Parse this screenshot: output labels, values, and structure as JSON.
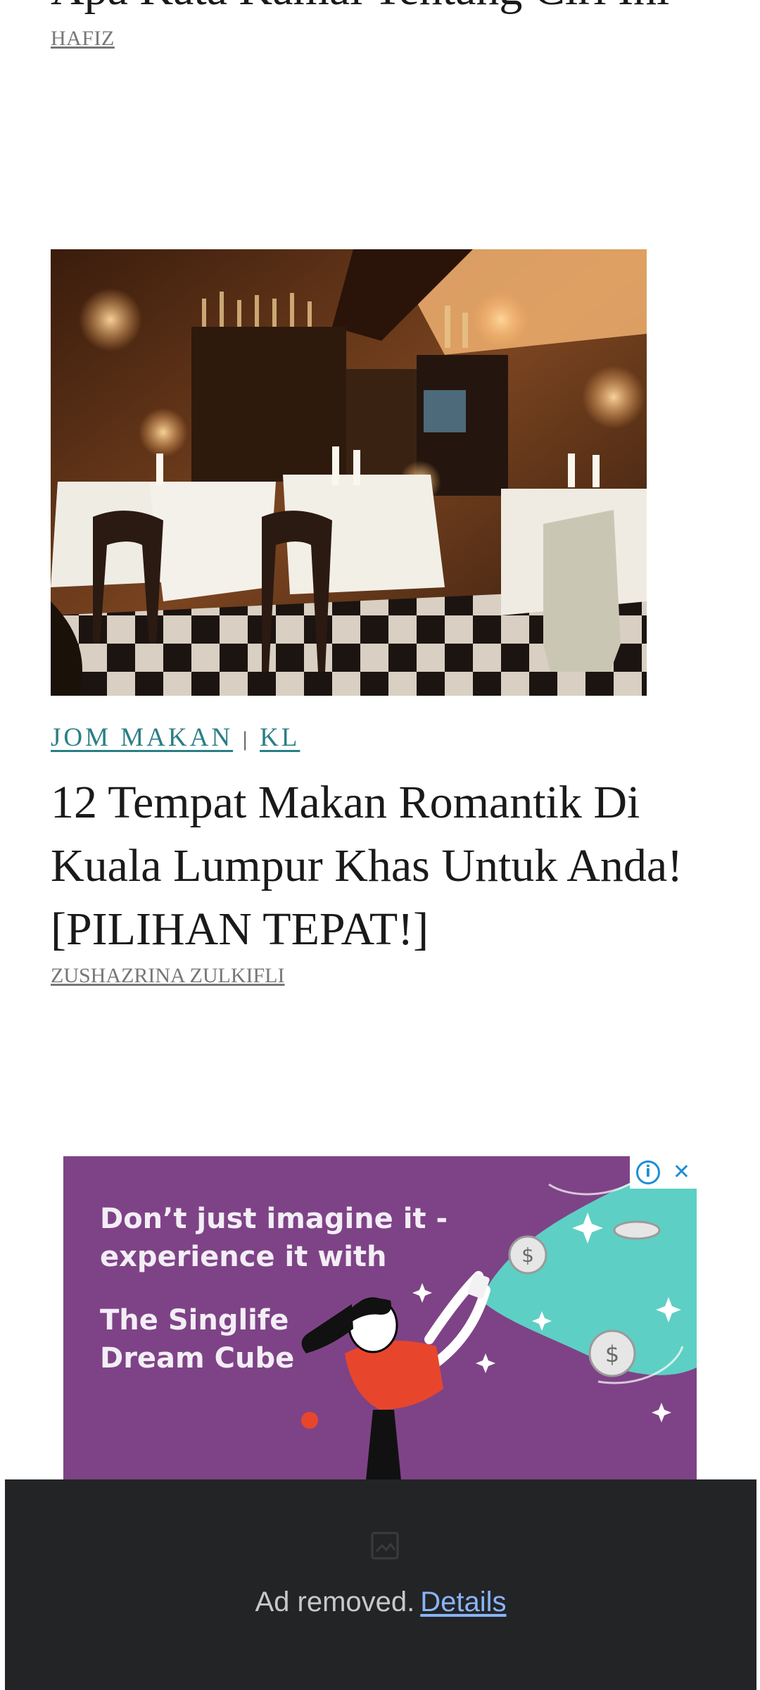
{
  "article_top": {
    "title": "Apa Kata Kamal Tentang Ciri Ini",
    "author": "HAFIZ"
  },
  "article_main": {
    "image_alt": "restaurant-interior-photo",
    "categories": [
      "JOM MAKAN",
      "KL"
    ],
    "separator": "|",
    "title": "12 Tempat Makan Romantik Di Kuala Lumpur Khas Untuk Anda! [PILIHAN TEPAT!]",
    "author": "ZUSHAZRINA ZULKIFLI"
  },
  "ad": {
    "line1": "Don’t just imagine it - experience it with",
    "line2": "The Singlife Dream Cube",
    "info_icon": "info-icon",
    "close_icon": "close-icon",
    "background": "#7e4386",
    "accent": "#5ecfc4"
  },
  "ad_removed": {
    "message": "Ad removed.",
    "details_link": "Details"
  }
}
